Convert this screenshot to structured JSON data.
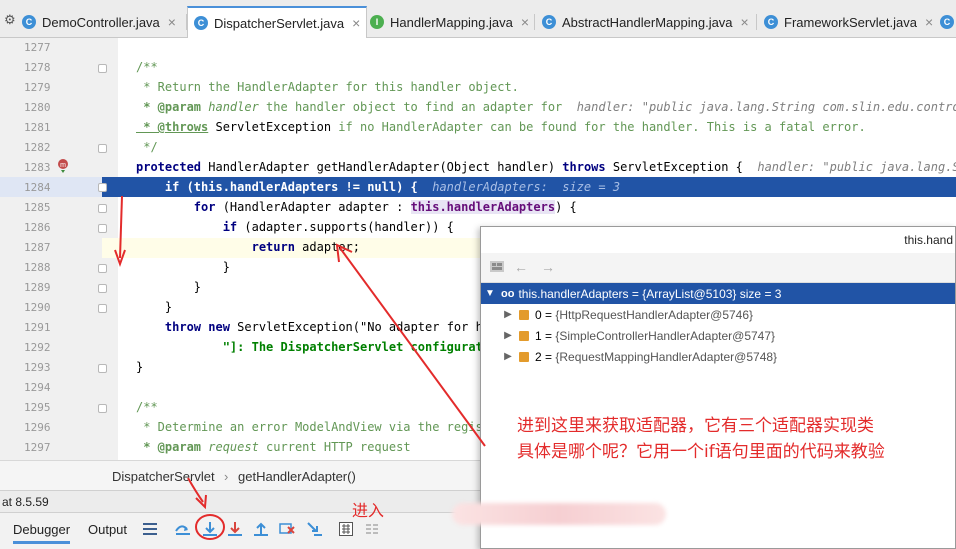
{
  "tabs": [
    {
      "label": "DemoController.java",
      "icon": "class-icon",
      "active": false
    },
    {
      "label": "DispatcherServlet.java",
      "icon": "class-icon",
      "active": true
    },
    {
      "label": "HandlerMapping.java",
      "icon": "interface-icon",
      "active": false
    },
    {
      "label": "AbstractHandlerMapping.java",
      "icon": "class-icon",
      "active": false
    },
    {
      "label": "FrameworkServlet.java",
      "icon": "class-icon",
      "active": false
    }
  ],
  "close_glyph": "×",
  "editor": {
    "line_numbers": [
      "1277",
      "1278",
      "1279",
      "1280",
      "1281",
      "1282",
      "1283",
      "1284",
      "1285",
      "1286",
      "1287",
      "1288",
      "1289",
      "1290",
      "1291",
      "1292",
      "1293",
      "1294",
      "1295",
      "1296",
      "1297"
    ],
    "lines": {
      "l1278": "/**",
      "l1279": " * Return the HandlerAdapter for this handler object.",
      "l1280_a": " * @param",
      "l1280_b": " handler",
      "l1280_c": " the handler object to find an adapter for",
      "l1280_hint": "handler: \"public java.lang.String com.slin.edu.controlle",
      "l1281_a": " * @throws",
      "l1281_b": " ServletException",
      "l1281_c": " if no HandlerAdapter can be found for the handler. This is a fatal error.",
      "l1282": " */",
      "l1283_kw": "protected",
      "l1283_code": " HandlerAdapter getHandlerAdapter(Object handler) ",
      "l1283_kw2": "throws",
      "l1283_code2": " ServletException {",
      "l1283_hint": "handler: \"public java.lang.Strin",
      "l1284_code": "    if (this.handlerAdapters != null) {",
      "l1284_hint": "handlerAdapters:  size = 3",
      "l1285_kw": "for",
      "l1285_a": " (HandlerAdapter adapter : ",
      "l1285_fld": "this.handlerAdapters",
      "l1285_b": ") {",
      "l1286_kw": "if",
      "l1286_code": " (adapter.supports(handler)) {",
      "l1287_kw": "return",
      "l1287_code": " adapter;",
      "l1288": "}",
      "l1289": "}",
      "l1290": "}",
      "l1291_kw1": "throw",
      "l1291_kw2": "new",
      "l1291_code": " ServletException(\"No adapter for ha",
      "l1292": "\"]: The DispatcherServlet configurati",
      "l1293": "}",
      "l1295": "/**",
      "l1296": " * Determine an error ModelAndView via the regist",
      "l1297_a": " * @param",
      "l1297_b": " request",
      "l1297_c": " current HTTP request"
    }
  },
  "breadcrumb": {
    "class": "DispatcherServlet",
    "sep": "›",
    "method": "getHandlerAdapter()"
  },
  "server_label": "at 8.5.59",
  "debug_tabs": {
    "debugger": "Debugger",
    "output": "Output"
  },
  "popup": {
    "title": "this.hand",
    "root": {
      "label": "this.handlerAdapters = {ArrayList@5103}  size = 3",
      "badge": "oo"
    },
    "items": [
      {
        "index": "0",
        "value": "{HttpRequestHandlerAdapter@5746}"
      },
      {
        "index": "1",
        "value": "{SimpleControllerHandlerAdapter@5747}"
      },
      {
        "index": "2",
        "value": "{RequestMappingHandlerAdapter@5748}"
      }
    ]
  },
  "annotations": {
    "line1": "进到这里来获取适配器，它有三个适配器实现类",
    "line2": "具体是哪个呢？它用一个if语句里面的代码来教验",
    "enter": "进入"
  },
  "colors": {
    "accent": "#2154a6",
    "annotation": "#e32b2b"
  }
}
